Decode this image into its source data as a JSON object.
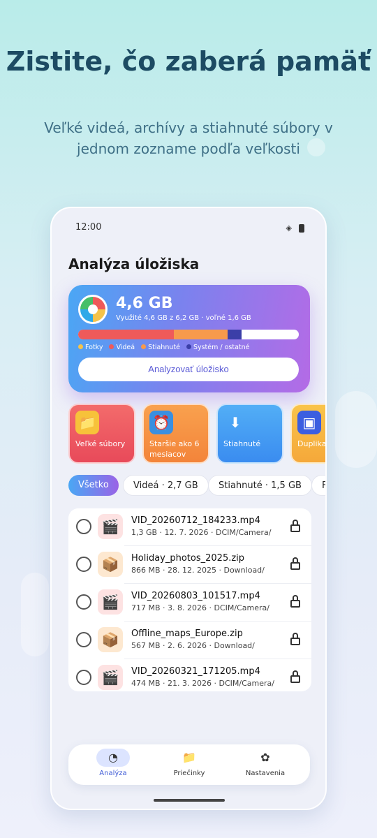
{
  "promo": {
    "title": "Zistite, čo zaberá pamäť",
    "subtitle": "Veľké videá, archívy a stiahnuté súbory v jednom zozname podľa veľkosti"
  },
  "status_bar": {
    "time": "12:00"
  },
  "screen": {
    "title": "Analýza úložiska"
  },
  "storage": {
    "used_big": "4,6 GB",
    "detail": "Využité 4,6 GB z 6,2 GB · voľné 1,6 GB",
    "segments": [
      {
        "name": "Fotky",
        "fraction": 0.0,
        "color": "#f5c34a"
      },
      {
        "name": "Videá",
        "fraction": 0.435,
        "color": "#ef5a5a"
      },
      {
        "name": "Stiahnuté",
        "fraction": 0.242,
        "color": "#f79a4c"
      },
      {
        "name": "Systém / ostatné",
        "fraction": 0.065,
        "color": "#3b3fa8"
      }
    ],
    "legend": [
      "Fotky",
      "Videá",
      "Stiahnuté",
      "Systém / ostatné"
    ],
    "analyze_button": "Analyzovať úložisko"
  },
  "categories": [
    {
      "label": "Veľké súbory",
      "icon": "folder-icon"
    },
    {
      "label": "Staršie ako 6 mesiacov",
      "icon": "clock-icon"
    },
    {
      "label": "Stiahnuté",
      "icon": "download-icon"
    },
    {
      "label": "Duplika",
      "icon": "duplicates-icon"
    }
  ],
  "filters": [
    "Všetko",
    "Videá · 2,7 GB",
    "Stiahnuté · 1,5 GB",
    "F"
  ],
  "files": [
    {
      "name": "VID_20260712_184233.mp4",
      "meta": "1,3 GB · 12. 7. 2026 · DCIM/Camera/",
      "type": "video"
    },
    {
      "name": "Holiday_photos_2025.zip",
      "meta": "866 MB · 28. 12. 2025 · Download/",
      "type": "zip"
    },
    {
      "name": "VID_20260803_101517.mp4",
      "meta": "717 MB · 3. 8. 2026 · DCIM/Camera/",
      "type": "video"
    },
    {
      "name": "Offline_maps_Europe.zip",
      "meta": "567 MB · 2. 6. 2026 · Download/",
      "type": "zip"
    },
    {
      "name": "VID_20260321_171205.mp4",
      "meta": "474 MB · 21. 3. 2026 · DCIM/Camera/",
      "type": "video"
    }
  ],
  "nav": [
    {
      "label": "Analýza",
      "icon": "analysis-icon"
    },
    {
      "label": "Priečinky",
      "icon": "folders-icon"
    },
    {
      "label": "Nastavenia",
      "icon": "settings-icon"
    }
  ]
}
